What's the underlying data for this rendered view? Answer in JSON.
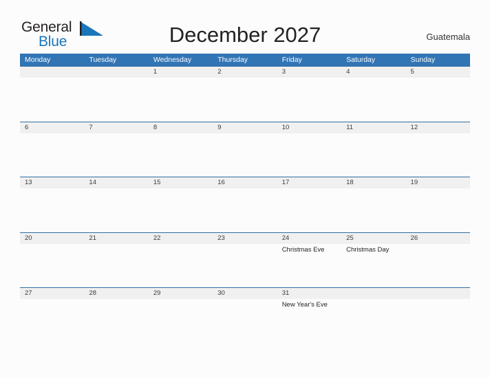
{
  "brand": {
    "name_part1": "General",
    "name_part2": "Blue",
    "flag_icon": "blue-triangle-flag-icon",
    "colors": {
      "text_dark": "#231f20",
      "blue": "#1b75bb"
    }
  },
  "header": {
    "title": "December 2027",
    "region": "Guatemala"
  },
  "calendar": {
    "colors": {
      "weekday_header_bg": "#3275b5",
      "weekday_header_text": "#ffffff",
      "row_divider": "#2e6da4",
      "day_strip_bg": "#f0f0f0",
      "day_number_text": "#3a3a3a",
      "event_text": "#222222",
      "page_bg": "#fcfcfc"
    },
    "weekdays": [
      "Monday",
      "Tuesday",
      "Wednesday",
      "Thursday",
      "Friday",
      "Saturday",
      "Sunday"
    ],
    "weeks": [
      [
        {
          "day": "",
          "event": ""
        },
        {
          "day": "",
          "event": ""
        },
        {
          "day": "1",
          "event": ""
        },
        {
          "day": "2",
          "event": ""
        },
        {
          "day": "3",
          "event": ""
        },
        {
          "day": "4",
          "event": ""
        },
        {
          "day": "5",
          "event": ""
        }
      ],
      [
        {
          "day": "6",
          "event": ""
        },
        {
          "day": "7",
          "event": ""
        },
        {
          "day": "8",
          "event": ""
        },
        {
          "day": "9",
          "event": ""
        },
        {
          "day": "10",
          "event": ""
        },
        {
          "day": "11",
          "event": ""
        },
        {
          "day": "12",
          "event": ""
        }
      ],
      [
        {
          "day": "13",
          "event": ""
        },
        {
          "day": "14",
          "event": ""
        },
        {
          "day": "15",
          "event": ""
        },
        {
          "day": "16",
          "event": ""
        },
        {
          "day": "17",
          "event": ""
        },
        {
          "day": "18",
          "event": ""
        },
        {
          "day": "19",
          "event": ""
        }
      ],
      [
        {
          "day": "20",
          "event": ""
        },
        {
          "day": "21",
          "event": ""
        },
        {
          "day": "22",
          "event": ""
        },
        {
          "day": "23",
          "event": ""
        },
        {
          "day": "24",
          "event": "Christmas Eve"
        },
        {
          "day": "25",
          "event": "Christmas Day"
        },
        {
          "day": "26",
          "event": ""
        }
      ],
      [
        {
          "day": "27",
          "event": ""
        },
        {
          "day": "28",
          "event": ""
        },
        {
          "day": "29",
          "event": ""
        },
        {
          "day": "30",
          "event": ""
        },
        {
          "day": "31",
          "event": "New Year's Eve"
        },
        {
          "day": "",
          "event": ""
        },
        {
          "day": "",
          "event": ""
        }
      ]
    ]
  }
}
